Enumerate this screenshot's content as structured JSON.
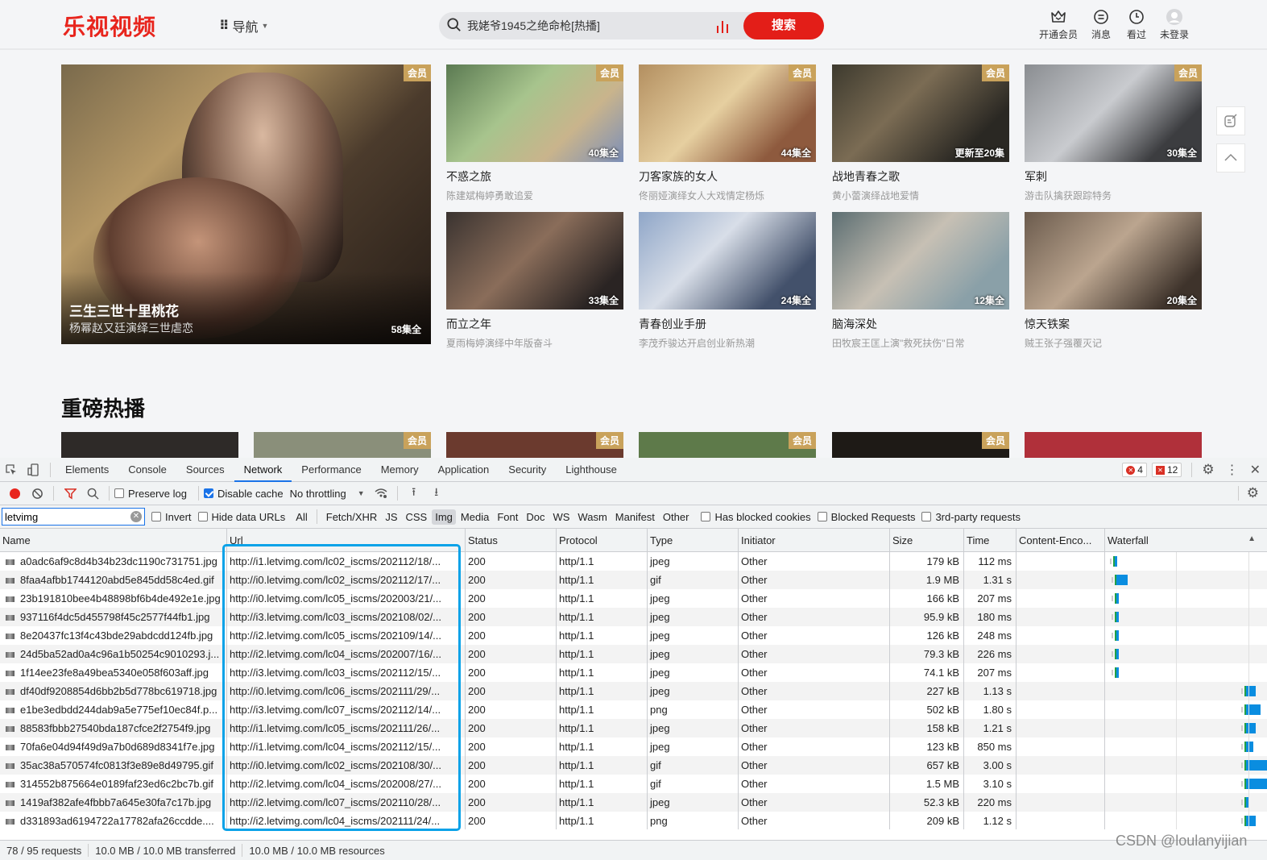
{
  "site": {
    "logo": "乐视视频",
    "nav_label": "导航",
    "search_value": "我姥爷1945之绝命枪[热播]",
    "search_button": "搜索",
    "header_icons": [
      {
        "name": "vip",
        "label": "开通会员"
      },
      {
        "name": "message",
        "label": "消息"
      },
      {
        "name": "history",
        "label": "看过"
      },
      {
        "name": "login",
        "label": "未登录"
      }
    ],
    "vip_badge": "会员",
    "hero": {
      "title": "三生三世十里桃花",
      "subtitle": "杨幂赵又廷演绎三世虐恋",
      "episodes": "58集全"
    },
    "cards": [
      {
        "title": "不惑之旅",
        "subtitle": "陈建斌梅婷勇敢追爱",
        "episodes": "40集全",
        "vip": true
      },
      {
        "title": "刀客家族的女人",
        "subtitle": "佟丽娅演绎女人大戏情定杨烁",
        "episodes": "44集全",
        "vip": true
      },
      {
        "title": "战地青春之歌",
        "subtitle": "黄小蕾演绎战地爱情",
        "episodes": "更新至20集",
        "vip": true
      },
      {
        "title": "军刺",
        "subtitle": "游击队擒获跟踪特务",
        "episodes": "30集全",
        "vip": true
      },
      {
        "title": "而立之年",
        "subtitle": "夏雨梅婷演绎中年版奋斗",
        "episodes": "33集全",
        "vip": false
      },
      {
        "title": "青春创业手册",
        "subtitle": "李茂乔骏达开启创业新热潮",
        "episodes": "24集全",
        "vip": false
      },
      {
        "title": "脑海深处",
        "subtitle": "田牧宸王匡上演\"救死扶伤\"日常",
        "episodes": "12集全",
        "vip": false
      },
      {
        "title": "惊天铁案",
        "subtitle": "贼王张子强覆灭记",
        "episodes": "20集全",
        "vip": false
      }
    ],
    "section_title": "重磅热播",
    "row2_vip": [
      false,
      true,
      true,
      true,
      true,
      false
    ]
  },
  "devtools": {
    "tabs": [
      "Elements",
      "Console",
      "Sources",
      "Network",
      "Performance",
      "Memory",
      "Application",
      "Security",
      "Lighthouse"
    ],
    "active_tab": "Network",
    "error_count": "4",
    "issue_count": "12",
    "toolbar": {
      "preserve_log": "Preserve log",
      "preserve_log_checked": false,
      "disable_cache": "Disable cache",
      "disable_cache_checked": true,
      "throttling": "No throttling"
    },
    "filter": {
      "value": "letvimg",
      "invert": "Invert",
      "hide_data_urls": "Hide data URLs",
      "types": [
        "All",
        "Fetch/XHR",
        "JS",
        "CSS",
        "Img",
        "Media",
        "Font",
        "Doc",
        "WS",
        "Wasm",
        "Manifest",
        "Other"
      ],
      "active_type": "Img",
      "has_blocked_cookies": "Has blocked cookies",
      "blocked_requests": "Blocked Requests",
      "third_party": "3rd-party requests"
    },
    "columns": [
      "Name",
      "Url",
      "Status",
      "Protocol",
      "Type",
      "Initiator",
      "Size",
      "Time",
      "Content-Enco...",
      "Waterfall"
    ],
    "rows": [
      {
        "name": "a0adc6af9c8d4b34b23dc1190c731751.jpg",
        "url": "http://i1.letvimg.com/lc02_iscms/202112/18/...",
        "status": "200",
        "protocol": "http/1.1",
        "type": "jpeg",
        "initiator": "Other",
        "size": "179 kB",
        "time": "112 ms",
        "wf_start": 0.02,
        "wf_len": 0.01
      },
      {
        "name": "8faa4afbb1744120abd5e845dd58c4ed.gif",
        "url": "http://i0.letvimg.com/lc02_iscms/202112/17/...",
        "status": "200",
        "protocol": "http/1.1",
        "type": "gif",
        "initiator": "Other",
        "size": "1.9 MB",
        "time": "1.31 s",
        "wf_start": 0.03,
        "wf_len": 0.07
      },
      {
        "name": "23b191810bee4b48898bf6b4de492e1e.jpg",
        "url": "http://i0.letvimg.com/lc05_iscms/202003/21/...",
        "status": "200",
        "protocol": "http/1.1",
        "type": "jpeg",
        "initiator": "Other",
        "size": "166 kB",
        "time": "207 ms",
        "wf_start": 0.03,
        "wf_len": 0.015
      },
      {
        "name": "937116f4dc5d455798f45c2577f44fb1.jpg",
        "url": "http://i3.letvimg.com/lc03_iscms/202108/02/...",
        "status": "200",
        "protocol": "http/1.1",
        "type": "jpeg",
        "initiator": "Other",
        "size": "95.9 kB",
        "time": "180 ms",
        "wf_start": 0.03,
        "wf_len": 0.015
      },
      {
        "name": "8e20437fc13f4c43bde29abdcdd124fb.jpg",
        "url": "http://i2.letvimg.com/lc05_iscms/202109/14/...",
        "status": "200",
        "protocol": "http/1.1",
        "type": "jpeg",
        "initiator": "Other",
        "size": "126 kB",
        "time": "248 ms",
        "wf_start": 0.03,
        "wf_len": 0.015
      },
      {
        "name": "24d5ba52ad0a4c96a1b50254c9010293.j...",
        "url": "http://i2.letvimg.com/lc04_iscms/202007/16/...",
        "status": "200",
        "protocol": "http/1.1",
        "type": "jpeg",
        "initiator": "Other",
        "size": "79.3 kB",
        "time": "226 ms",
        "wf_start": 0.03,
        "wf_len": 0.015
      },
      {
        "name": "1f14ee23fe8a49bea5340e058f603aff.jpg",
        "url": "http://i3.letvimg.com/lc03_iscms/202112/15/...",
        "status": "200",
        "protocol": "http/1.1",
        "type": "jpeg",
        "initiator": "Other",
        "size": "74.1 kB",
        "time": "207 ms",
        "wf_start": 0.03,
        "wf_len": 0.015
      },
      {
        "name": "df40df9208854d6bb2b5d778bc619718.jpg",
        "url": "http://i0.letvimg.com/lc06_iscms/202111/29/...",
        "status": "200",
        "protocol": "http/1.1",
        "type": "jpeg",
        "initiator": "Other",
        "size": "227 kB",
        "time": "1.13 s",
        "wf_start": 0.83,
        "wf_len": 0.06
      },
      {
        "name": "e1be3edbdd244dab9a5e775ef10ec84f.p...",
        "url": "http://i3.letvimg.com/lc07_iscms/202112/14/...",
        "status": "200",
        "protocol": "http/1.1",
        "type": "png",
        "initiator": "Other",
        "size": "502 kB",
        "time": "1.80 s",
        "wf_start": 0.83,
        "wf_len": 0.09
      },
      {
        "name": "88583fbbb27540bda187cfce2f2754f9.jpg",
        "url": "http://i1.letvimg.com/lc05_iscms/202111/26/...",
        "status": "200",
        "protocol": "http/1.1",
        "type": "jpeg",
        "initiator": "Other",
        "size": "158 kB",
        "time": "1.21 s",
        "wf_start": 0.83,
        "wf_len": 0.06
      },
      {
        "name": "70fa6e04d94f49d9a7b0d689d8341f7e.jpg",
        "url": "http://i1.letvimg.com/lc04_iscms/202112/15/...",
        "status": "200",
        "protocol": "http/1.1",
        "type": "jpeg",
        "initiator": "Other",
        "size": "123 kB",
        "time": "850 ms",
        "wf_start": 0.83,
        "wf_len": 0.045
      },
      {
        "name": "35ac38a570574fc0813f3e89e8d49795.gif",
        "url": "http://i0.letvimg.com/lc02_iscms/202108/30/...",
        "status": "200",
        "protocol": "http/1.1",
        "type": "gif",
        "initiator": "Other",
        "size": "657 kB",
        "time": "3.00 s",
        "wf_start": 0.83,
        "wf_len": 0.14
      },
      {
        "name": "314552b875664e0189faf23ed6c2bc7b.gif",
        "url": "http://i2.letvimg.com/lc04_iscms/202008/27/...",
        "status": "200",
        "protocol": "http/1.1",
        "type": "gif",
        "initiator": "Other",
        "size": "1.5 MB",
        "time": "3.10 s",
        "wf_start": 0.83,
        "wf_len": 0.145
      },
      {
        "name": "1419af382afe4fbbb7a645e30fa7c17b.jpg",
        "url": "http://i2.letvimg.com/lc07_iscms/202110/28/...",
        "status": "200",
        "protocol": "http/1.1",
        "type": "jpeg",
        "initiator": "Other",
        "size": "52.3 kB",
        "time": "220 ms",
        "wf_start": 0.83,
        "wf_len": 0.02
      },
      {
        "name": "d331893ad6194722a17782afa26ccdde....",
        "url": "http://i2.letvimg.com/lc04_iscms/202111/24/...",
        "status": "200",
        "protocol": "http/1.1",
        "type": "png",
        "initiator": "Other",
        "size": "209 kB",
        "time": "1.12 s",
        "wf_start": 0.83,
        "wf_len": 0.06
      }
    ],
    "status_bar": {
      "requests": "78 / 95 requests",
      "transferred": "10.0 MB / 10.0 MB transferred",
      "resources": "10.0 MB / 10.0 MB resources"
    }
  },
  "watermark": "CSDN @loulanyijian"
}
